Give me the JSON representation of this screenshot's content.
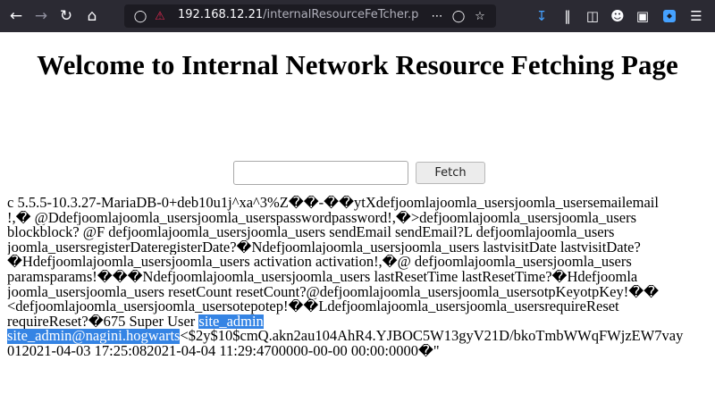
{
  "browser": {
    "back_icon": "arrow-left",
    "forward_icon": "arrow-right",
    "reload_icon": "reload",
    "home_icon": "home",
    "url_host": "192.168.12.21",
    "url_path": "/internalResourceFeTcher.php?u",
    "more_icon": "three-dots",
    "pocket_icon": "pocket",
    "bookmark_icon": "star",
    "download_icon": "download-arrow",
    "library_icon": "library",
    "sidebar_icon": "sidebar",
    "account_icon": "account",
    "extension_icon": "extension",
    "menu_icon": "hamburger-menu"
  },
  "page": {
    "title": "Welcome to Internal Network Resource Fetching Page",
    "input_value": "",
    "fetch_label": "Fetch"
  },
  "output": {
    "line1": "c 5.5.5-10.3.27-MariaDB-0+deb10u1j^xa^3%Z��-��ytXdefjoomlajoomla_usersjoomla_usersemailemail",
    "line2": "!,� @Ddefjoomlajoomla_usersjoomla_userspasswordpassword!,�>defjoomlajoomla_usersjoomla_users",
    "line3": "blockblock? @F defjoomlajoomla_usersjoomla_users sendEmail sendEmail?L defjoomlajoomla_users",
    "line4": "joomla_usersregisterDateregisterDate?�Ndefjoomlajoomla_usersjoomla_users lastvisitDate lastvisitDate?",
    "line5": "�Hdefjoomlajoomla_usersjoomla_users activation activation!,�@ defjoomlajoomla_usersjoomla_users",
    "line6": "paramsparams!���Ndefjoomlajoomla_usersjoomla_users lastResetTime lastResetTime?�Hdefjoomla",
    "line7": "joomla_usersjoomla_users resetCount resetCount?@defjoomlajoomla_usersjoomla_usersotpKeyotpKey!��",
    "line8": "<defjoomlajoomla_usersjoomla_usersotepotep!��Ldefjoomlajoomla_usersjoomla_usersrequireReset",
    "line9_pre": "requireReset?�675 Super User ",
    "line9_hl": "site_admin",
    "line10_hl": "site_admin@nagini.hogwarts",
    "line10_post": "<$2y$10$cmQ.akn2au104AhR4.YJBOC5W13gyV21D/bkoTmbWWqFWjzEW7vay",
    "line11": "012021-04-03 17:25:082021-04-04 11:29:4700000-00-00 00:00:0000�\""
  }
}
